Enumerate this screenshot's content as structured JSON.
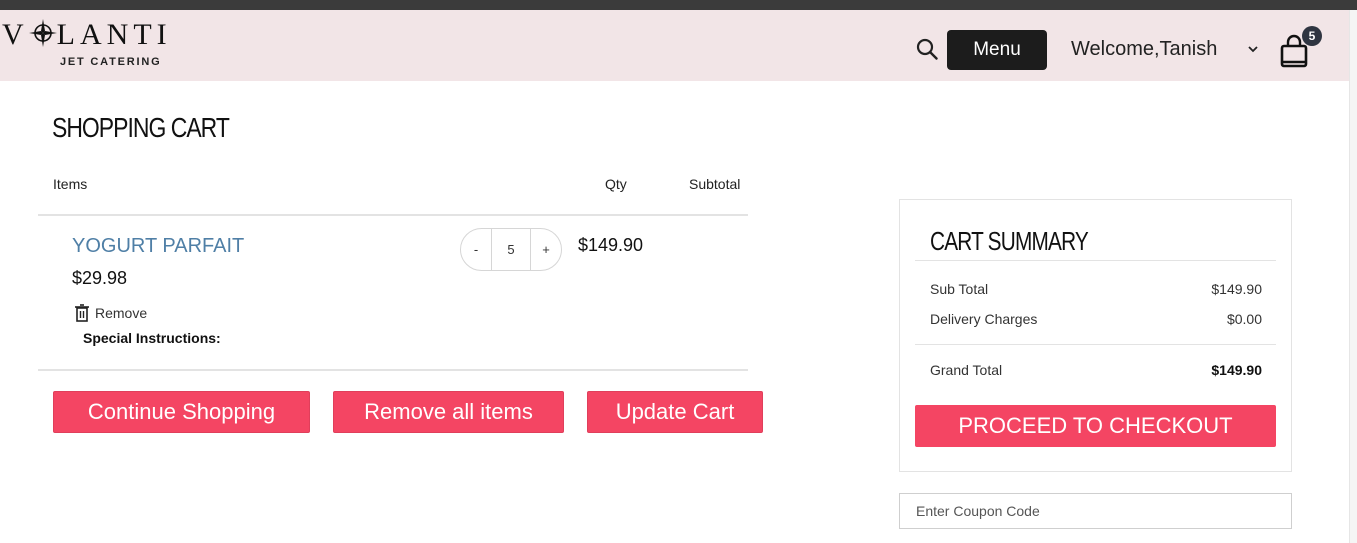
{
  "header": {
    "logo_main": "V LANTI",
    "logo_sub": "JET CATERING",
    "menu_label": "Menu",
    "welcome_text": "Welcome,Tanish",
    "cart_count": "5"
  },
  "cart": {
    "title": "SHOPPING CART",
    "columns": {
      "items": "Items",
      "qty": "Qty",
      "subtotal": "Subtotal"
    },
    "items": [
      {
        "name": "YOGURT PARFAIT",
        "price": "$29.98",
        "remove_label": "Remove",
        "special_label": "Special Instructions:",
        "qty": "5",
        "minus": "-",
        "plus": "+",
        "subtotal": "$149.90"
      }
    ],
    "buttons": {
      "continue": "Continue Shopping",
      "remove_all": "Remove all items",
      "update": "Update Cart"
    }
  },
  "summary": {
    "title": "CART SUMMARY",
    "sub_total_label": "Sub Total",
    "sub_total_value": "$149.90",
    "delivery_label": "Delivery Charges",
    "delivery_value": "$0.00",
    "grand_total_label": "Grand Total",
    "grand_total_value": "$149.90",
    "checkout_label": "PROCEED TO CHECKOUT",
    "coupon_placeholder": "Enter Coupon Code"
  },
  "colors": {
    "header_bg": "#f2e5e7",
    "accent": "#f44563",
    "link_blue": "#4f7fa6",
    "dark": "#1c1c1c"
  },
  "icons": [
    "compass-icon",
    "search-icon",
    "chevron-down-icon",
    "shopping-bag-icon",
    "trash-icon"
  ]
}
